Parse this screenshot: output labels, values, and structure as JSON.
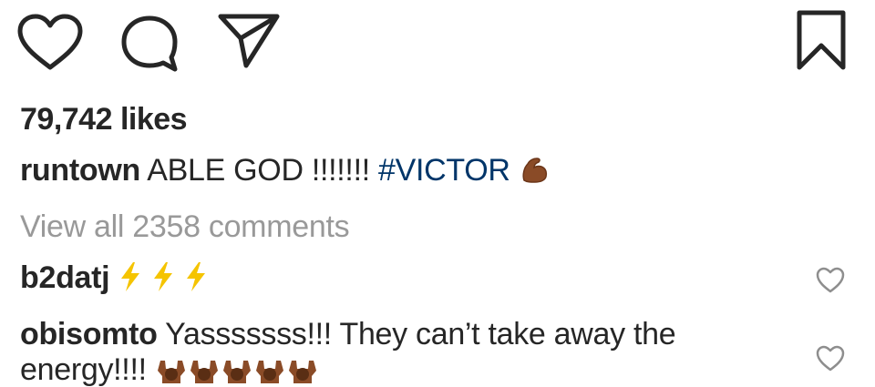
{
  "actions": {
    "like_icon": "heart-outline",
    "comment_icon": "speech-bubble-outline",
    "share_icon": "paper-plane-outline",
    "save_icon": "bookmark-outline"
  },
  "likes_text": "79,742 likes",
  "caption": {
    "username": "runtown",
    "text": "ABLE GOD !!!!!!! ",
    "hashtag": "#VICTOR",
    "emoji": "flexed-biceps"
  },
  "view_all_comments": "View all 2358 comments",
  "comments": [
    {
      "username": "b2datj",
      "text": "",
      "emojis": [
        "high-voltage",
        "high-voltage",
        "high-voltage"
      ]
    },
    {
      "username": "obisomto",
      "text_line1": "Yasssssss!!! They can’t take away the",
      "text_line2": "energy!!!!",
      "emojis": [
        "raising-hands-person",
        "raising-hands-person",
        "raising-hands-person",
        "raising-hands-person",
        "raising-hands-person"
      ]
    }
  ],
  "colors": {
    "text": "#262626",
    "hashtag": "#003569",
    "muted": "#999999",
    "bolt": "#f5c400",
    "skin": "#8a4b27"
  }
}
